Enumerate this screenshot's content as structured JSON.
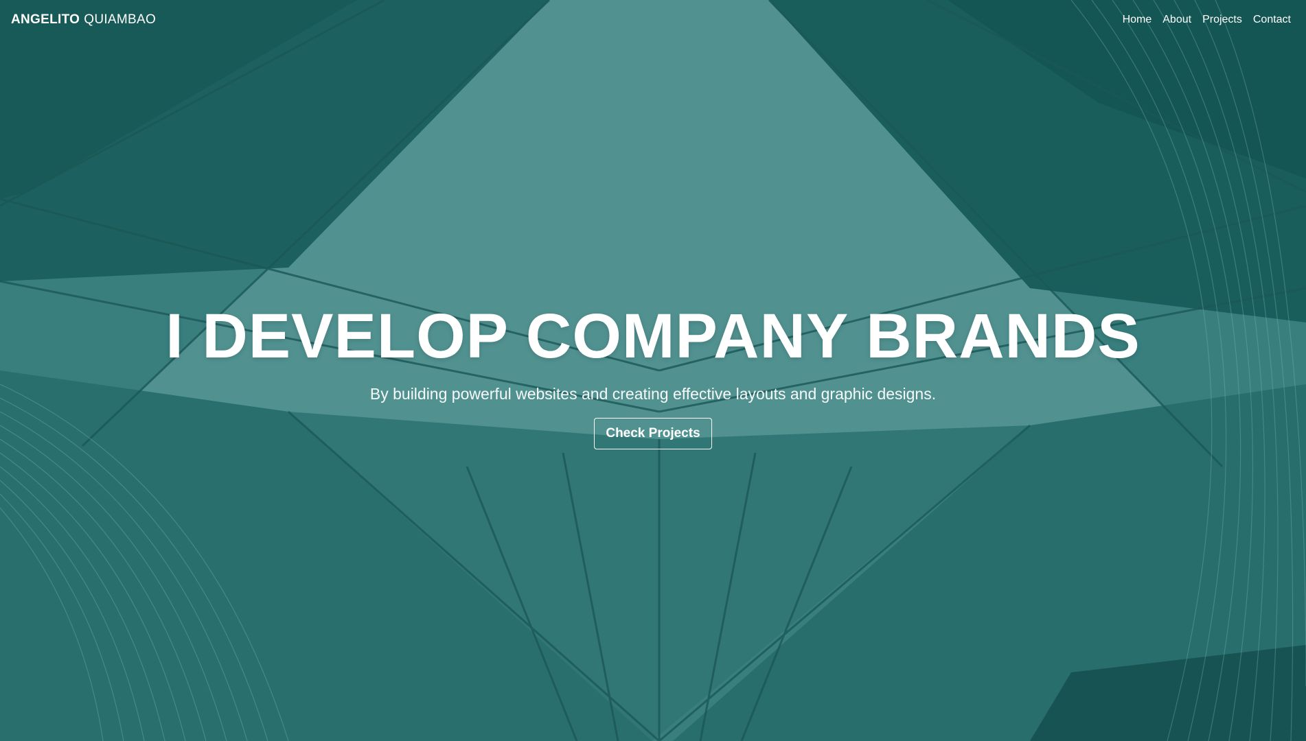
{
  "brand": {
    "first": "ANGELITO",
    "last": "QUIAMBAO"
  },
  "nav": {
    "items": [
      {
        "label": "Home"
      },
      {
        "label": "About"
      },
      {
        "label": "Projects"
      },
      {
        "label": "Contact"
      }
    ]
  },
  "hero": {
    "headline": "I DEVELOP COMPANY BRANDS",
    "subheadline": "By building powerful websites and creating effective layouts and graphic designs.",
    "cta_label": "Check Projects",
    "background_image": "building-architecture-photo"
  },
  "colors": {
    "overlay_teal": "#2f7674",
    "dark_teal": "#0f4f4d",
    "light_teal": "#5f9d9c",
    "text": "#ffffff"
  }
}
